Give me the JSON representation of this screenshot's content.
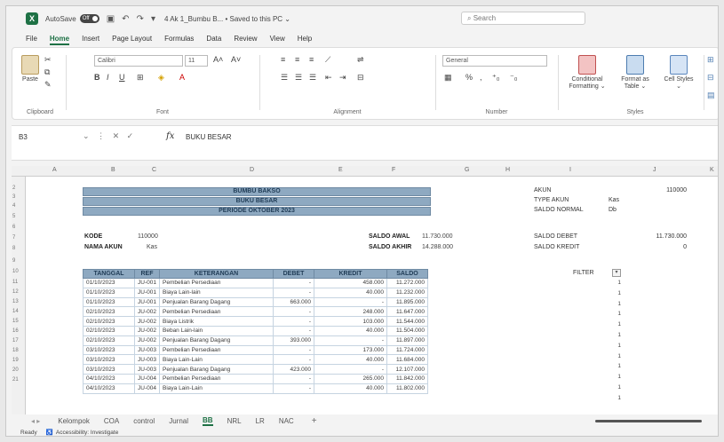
{
  "app": {
    "autosave_label": "AutoSave",
    "toggle_label": "Off",
    "file_title": "4 Ak 1_Bumbu B... • Saved to this PC ⌄",
    "search_placeholder": "Search"
  },
  "menu": [
    "File",
    "Home",
    "Insert",
    "Page Layout",
    "Formulas",
    "Data",
    "Review",
    "View",
    "Help"
  ],
  "ribbon": {
    "paste": "Paste",
    "clipboard": "Clipboard",
    "font_name": "Calibri",
    "font_size": "11",
    "font_group": "Font",
    "alignment_group": "Alignment",
    "number_format": "General",
    "number_group": "Number",
    "conditional_formatting": "Conditional Formatting ⌄",
    "format_as_table": "Format as Table ⌄",
    "cell_styles": "Cell Styles ⌄",
    "styles_group": "Styles"
  },
  "formula_bar": {
    "name_box": "B3",
    "fx": "fx",
    "formula": "BUKU BESAR"
  },
  "grid": {
    "columns": [
      "A",
      "B",
      "C",
      "D",
      "E",
      "F",
      "G",
      "H",
      "I",
      "J",
      "K"
    ],
    "rows": [
      "2",
      "3",
      "4",
      "5",
      "6",
      "7",
      "8",
      "9",
      "10",
      "11",
      "12",
      "13",
      "14",
      "15",
      "16",
      "17",
      "18",
      "19",
      "20",
      "21"
    ]
  },
  "sheet": {
    "title1": "BUMBU BAKSO",
    "title2": "BUKU BESAR",
    "title3": "PERIODE OKTOBER 2023",
    "kode_label": "KODE",
    "kode_value": "110000",
    "nama_akun_label": "NAMA AKUN",
    "nama_akun_value": "Kas",
    "saldo_awal_label": "SALDO AWAL",
    "saldo_awal_value": "11.730.000",
    "saldo_akhir_label": "SALDO AKHIR",
    "saldo_akhir_value": "14.288.000",
    "headers": [
      "TANGGAL",
      "REF",
      "KETERANGAN",
      "DEBET",
      "KREDIT",
      "SALDO"
    ],
    "rows": [
      [
        "01/10/2023",
        "JU-001",
        "Pembelian Persediaan",
        "-",
        "458.000",
        "11.272.000"
      ],
      [
        "01/10/2023",
        "JU-001",
        "Biaya Lain-lain",
        "-",
        "40.000",
        "11.232.000"
      ],
      [
        "01/10/2023",
        "JU-001",
        "Penjualan Barang Dagang",
        "663.000",
        "-",
        "11.895.000"
      ],
      [
        "02/10/2023",
        "JU-002",
        "Pembelian Persediaan",
        "-",
        "248.000",
        "11.647.000"
      ],
      [
        "02/10/2023",
        "JU-002",
        "Biaya Listrik",
        "-",
        "103.000",
        "11.544.000"
      ],
      [
        "02/10/2023",
        "JU-002",
        "Beban Lain-lain",
        "-",
        "40.000",
        "11.504.000"
      ],
      [
        "02/10/2023",
        "JU-002",
        "Penjualan Barang Dagang",
        "393.000",
        "-",
        "11.897.000"
      ],
      [
        "03/10/2023",
        "JU-003",
        "Pembelian Persediaan",
        "-",
        "173.000",
        "11.724.000"
      ],
      [
        "03/10/2023",
        "JU-003",
        "Biaya Lain-Lain",
        "-",
        "40.000",
        "11.684.000"
      ],
      [
        "03/10/2023",
        "JU-003",
        "Penjualan Barang Dagang",
        "423.000",
        "-",
        "12.107.000"
      ],
      [
        "04/10/2023",
        "JU-004",
        "Pembelian Persediaan",
        "-",
        "265.000",
        "11.842.000"
      ],
      [
        "04/10/2023",
        "JU-004",
        "Biaya Lain-Lain",
        "-",
        "40.000",
        "11.802.000"
      ]
    ],
    "side": {
      "akun_label": "AKUN",
      "akun_value": "110000",
      "type_akun_label": "TYPE AKUN",
      "type_akun_value": "Kas",
      "saldo_normal_label": "SALDO NORMAL",
      "saldo_normal_value": "Db",
      "saldo_debet_label": "SALDO DEBET",
      "saldo_debet_value": "11.730.000",
      "saldo_kredit_label": "SALDO KREDIT",
      "saldo_kredit_value": "0",
      "filter_label": "FILTER",
      "filter_values": [
        "1",
        "1",
        "1",
        "1",
        "1",
        "1",
        "1",
        "1",
        "1",
        "1",
        "1",
        "1"
      ]
    }
  },
  "sheet_tabs": [
    "Kelompok",
    "COA",
    "control",
    "Jurnal",
    "BB",
    "NRL",
    "LR",
    "NAC"
  ],
  "active_sheet": "BB",
  "status": {
    "ready": "Ready",
    "accessibility": "Accessibility: Investigate"
  }
}
